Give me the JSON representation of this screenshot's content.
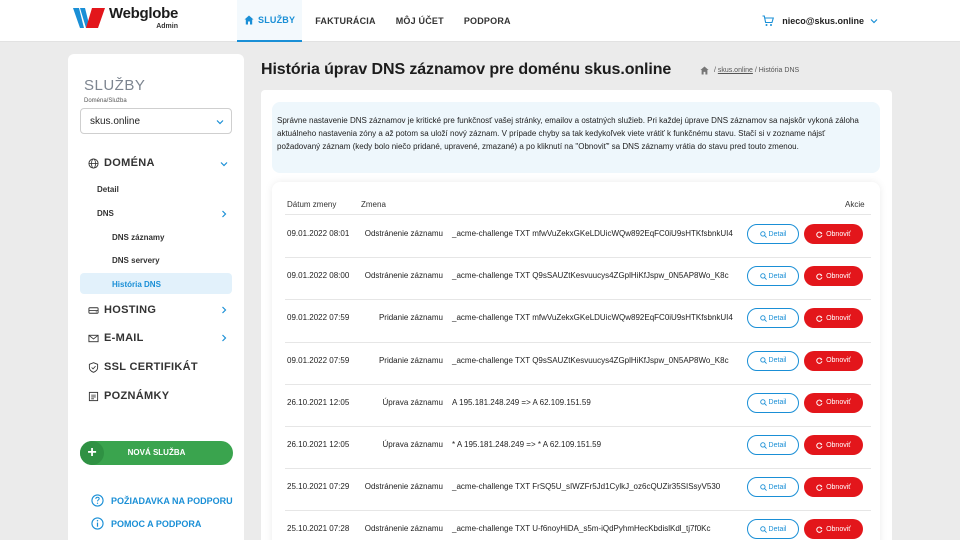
{
  "brand": {
    "name": "Webglobe",
    "sub": "Admin",
    "colors": {
      "w_blue": "#1a8fd6",
      "w_red": "#e3161b"
    }
  },
  "nav": [
    {
      "label": "SLUŽBY",
      "icon": "home-icon",
      "active": true
    },
    {
      "label": "FAKTURÁCIA"
    },
    {
      "label": "MÔJ ÚČET"
    },
    {
      "label": "PODPORA"
    }
  ],
  "user": {
    "email": "nieco@skus.online",
    "cart_icon": "cart-icon"
  },
  "sidebar": {
    "title": "SLUŽBY",
    "select_label": "Doména/Služba",
    "select_value": "skus.online",
    "sections": {
      "domena": "DOMÉNA",
      "detail": "Detail",
      "dns": "DNS",
      "dns_zaznamy": "DNS záznamy",
      "dns_servery": "DNS servery",
      "historia_dns": "História DNS",
      "hosting": "HOSTING",
      "email": "E-MAIL",
      "ssl": "SSL CERTIFIKÁT",
      "poznamky": "POZNÁMKY"
    },
    "new_service": "NOVÁ SLUŽBA",
    "links": {
      "support_request": "POŽIADAVKA NA PODPORU",
      "help": "POMOC A PODPORA"
    }
  },
  "main": {
    "title": "História úprav DNS záznamov pre doménu skus.online",
    "breadcrumb": {
      "link": "skus.online",
      "current": "/ História DNS"
    },
    "info": "Správne nastavenie DNS záznamov je kritické pre funkčnosť vašej stránky, emailov a ostatných služieb. Pri každej úprave DNS záznamov sa najskôr vykoná záloha aktuálneho nastavenia zóny a až potom sa uloží nový záznam. V prípade chyby sa tak kedykoľvek viete vrátiť k funkčnému stavu. Stačí si v zozname nájsť požadovaný záznam (kedy bolo niečo pridané, upravené, zmazané) a po kliknutí na \"Obnoviť\" sa DNS záznamy vrátia do stavu pred touto zmenou.",
    "table": {
      "headers": {
        "date": "Dátum zmeny",
        "change": "Zmena",
        "actions": "Akcie"
      },
      "detail_label": "Detail",
      "restore_label": "Obnoviť",
      "rows": [
        {
          "date": "09.01.2022 08:01",
          "type": "Odstránenie záznamu",
          "record": "_acme-challenge TXT mfwVuZekxGKeLDUicWQw892EqFC0iU9sHTKfsbnkUI4"
        },
        {
          "date": "09.01.2022 08:00",
          "type": "Odstránenie záznamu",
          "record": "_acme-challenge TXT Q9sSAUZtKesvuucys4ZGplHiKfJspw_0N5AP8Wo_K8c"
        },
        {
          "date": "09.01.2022 07:59",
          "type": "Pridanie záznamu",
          "record": "_acme-challenge TXT mfwVuZekxGKeLDUicWQw892EqFC0iU9sHTKfsbnkUI4"
        },
        {
          "date": "09.01.2022 07:59",
          "type": "Pridanie záznamu",
          "record": "_acme-challenge TXT Q9sSAUZtKesvuucys4ZGplHiKfJspw_0N5AP8Wo_K8c"
        },
        {
          "date": "26.10.2021 12:05",
          "type": "Úprava záznamu",
          "record": "A 195.181.248.249 => A 62.109.151.59"
        },
        {
          "date": "26.10.2021 12:05",
          "type": "Úprava záznamu",
          "record": "* A 195.181.248.249 => * A 62.109.151.59"
        },
        {
          "date": "25.10.2021 07:29",
          "type": "Odstránenie záznamu",
          "record": "_acme-challenge TXT FrSQ5U_sIWZFr5Jd1CylkJ_oz6cQUZir35SISsyV530"
        },
        {
          "date": "25.10.2021 07:28",
          "type": "Odstránenie záznamu",
          "record": "_acme-challenge TXT U-f6noyHiDA_s5m-iQdPyhmHecKbdislKdl_tj7f0Kc"
        }
      ]
    }
  }
}
